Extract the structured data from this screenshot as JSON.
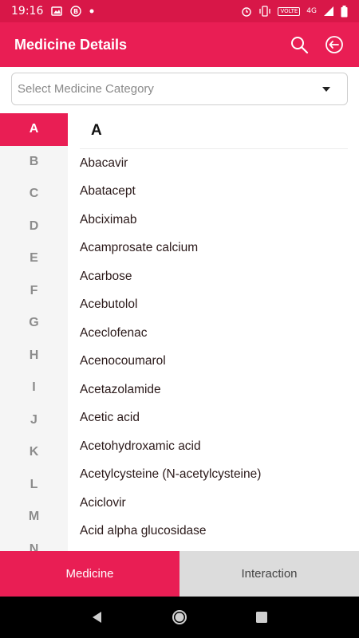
{
  "status_bar": {
    "time": "19:16",
    "icons_left": [
      "image-icon",
      "b-circle-icon",
      "dot-icon"
    ],
    "icons_right": [
      "alarm-icon",
      "vibrate-icon",
      "volte-icon",
      "4g-icon",
      "signal-icon",
      "battery-icon"
    ],
    "volte_label": "VOLTE",
    "network_label": "4G"
  },
  "app_bar": {
    "title": "Medicine Details",
    "actions": [
      "search-icon",
      "logout-icon"
    ]
  },
  "category_select": {
    "placeholder": "Select Medicine Category"
  },
  "alphabet": {
    "letters": [
      "A",
      "B",
      "C",
      "D",
      "E",
      "F",
      "G",
      "H",
      "I",
      "J",
      "K",
      "L",
      "M",
      "N"
    ],
    "active": "A"
  },
  "list": {
    "section_header": "A",
    "items": [
      "Abacavir",
      "Abatacept",
      "Abciximab",
      "Acamprosate calcium",
      "Acarbose",
      "Acebutolol",
      "Aceclofenac",
      "Acenocoumarol",
      "Acetazolamide",
      "Acetic acid",
      "Acetohydroxamic acid",
      "Acetylcysteine (N-acetylcysteine)",
      "Aciclovir",
      "Acid alpha glucosidase"
    ]
  },
  "bottom_tabs": {
    "medicine": "Medicine",
    "interaction": "Interaction",
    "active": "Medicine"
  },
  "nav_bar": {
    "buttons": [
      "back-icon",
      "home-icon",
      "recents-icon"
    ]
  },
  "colors": {
    "accent": "#e91e54",
    "status_bar": "#d81748",
    "inactive_tab": "#dcdcdc"
  }
}
